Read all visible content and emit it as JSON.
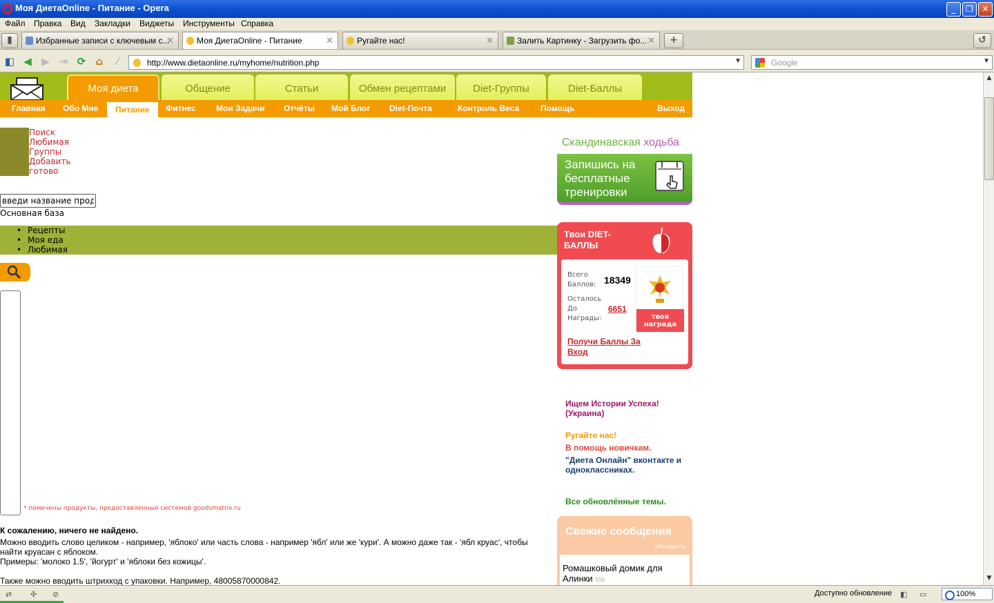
{
  "window": {
    "title": "Моя ДиетаOnline - Питание - Opera",
    "buttons": {
      "minimize": "_",
      "maximize": "❐",
      "close": "✕"
    }
  },
  "menu": [
    "Файл",
    "Правка",
    "Вид",
    "Закладки",
    "Виджеты",
    "Инструменты",
    "Справка"
  ],
  "tabs": [
    {
      "label": "Избранные записи с ключевым с...",
      "active": false
    },
    {
      "label": "Моя ДиетаOnline - Питание",
      "active": true
    },
    {
      "label": "Ругайте нас!",
      "active": false
    },
    {
      "label": "Залить Картинку - Загрузить фо...",
      "active": false
    }
  ],
  "address": {
    "url": "http://www.dietaonline.ru/myhome/nutrition.php",
    "search_placeholder": "Google"
  },
  "site": {
    "main_tabs": [
      "Моя диета",
      "Общение",
      "Статьи",
      "Обмен рецептами",
      "Diet-Группы",
      "Diet-Баллы"
    ],
    "sub_nav": [
      "Главная",
      "Обо Мне",
      "Питание",
      "Фитнес",
      "Мои Задачи",
      "Отчёты",
      "Мой Блог",
      "Diet-Почта",
      "Контроль Веса",
      "Помощь",
      "Выход"
    ],
    "left_links": [
      "Поиск",
      "Любимая",
      "Группы",
      "Добавить",
      "готово"
    ],
    "product_input_value": "введи название проду",
    "base_label": "Основная база",
    "olive_list": [
      "Рецепты",
      "Моя еда",
      "Любимая"
    ],
    "goodsmatrix_note": "* помечены продукты, предоставленные системой goodsmatrix.ru",
    "not_found_title": "К сожалению, ничего не найдено.",
    "not_found_lines": [
      "Можно вводить слово целиком - например, 'яблоко' или часть слова - например 'ябл' или же 'кури'. А можно даже так - 'ябл круас', чтобы",
      "найти круасан с яблоком.",
      "Примеры: 'молоко 1.5', 'йогурт' и 'яблоки без кожицы'.",
      "",
      "Также можно вводить штрихкод с упаковки. Например, 48005870000842."
    ]
  },
  "sidebar": {
    "scand": {
      "title_1": "Скандинавская",
      "title_2": "ходьба",
      "body": "Запишись на бесплатные тренировки"
    },
    "points": {
      "header": "Твои DIET-БАЛЛЫ",
      "total_label": "Всего Баллов:",
      "total_value": "18349",
      "remain_label": "Осталось До Награды:",
      "remain_value": "6651",
      "award_caption": "твоя награда",
      "get_link": "Получи Баллы За Вход"
    },
    "links": [
      {
        "text": "Ищем Истории Успеха! (Украина)",
        "color": "#a0156e"
      },
      {
        "text": "Ругайте нас!",
        "color": "#f49b00"
      },
      {
        "text": "В помощь новичкам.",
        "color": "#e0453a"
      },
      {
        "text": "\"Диета Онлайн\" вконтакте и одноклассниках.",
        "color": "#1a3d6e"
      },
      {
        "text": "Все обновлённые темы.",
        "color": "#2f8a1f"
      }
    ],
    "fresh": {
      "title": "Свежие сообщения",
      "refresh": "обновить",
      "item": "Ромашковый домик для Алинки",
      "item_count": "559"
    }
  },
  "status": {
    "update_text": "Доступно обновление",
    "zoom": "100%"
  },
  "colors": {
    "site_green": "#9fbc1a",
    "site_orange": "#f49b00",
    "points_red": "#f04b50",
    "link_red": "#c0272d"
  }
}
